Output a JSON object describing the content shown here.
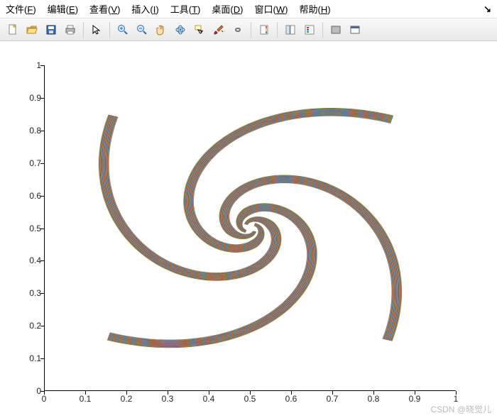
{
  "menu": {
    "items": [
      {
        "label": "文件",
        "key": "F"
      },
      {
        "label": "编辑",
        "key": "E"
      },
      {
        "label": "查看",
        "key": "V"
      },
      {
        "label": "插入",
        "key": "I"
      },
      {
        "label": "工具",
        "key": "T"
      },
      {
        "label": "桌面",
        "key": "D"
      },
      {
        "label": "窗口",
        "key": "W"
      },
      {
        "label": "帮助",
        "key": "H"
      }
    ]
  },
  "toolbar": {
    "icons": [
      "new",
      "open",
      "save",
      "print",
      "pointer",
      "zoom-in",
      "zoom-out",
      "pan",
      "rotate",
      "datacursor",
      "brush",
      "link",
      "colorbar",
      "legend",
      "insert-rect",
      "insert-box",
      "dock",
      "undock"
    ]
  },
  "chart_data": {
    "type": "line",
    "title": "",
    "xlabel": "",
    "ylabel": "",
    "xlim": [
      0,
      1
    ],
    "ylim": [
      0,
      1
    ],
    "xticks": [
      0,
      0.1,
      0.2,
      0.3,
      0.4,
      0.5,
      0.6,
      0.7,
      0.8,
      0.9,
      1
    ],
    "yticks": [
      0,
      0.1,
      0.2,
      0.3,
      0.4,
      0.5,
      0.6,
      0.7,
      0.8,
      0.9,
      1
    ],
    "note": "Four logarithmic spiral arms converging to center (0.5, 0.5); each arm rendered as a band of many offset colored strokes producing a striped tube effect.",
    "center": [
      0.5,
      0.5
    ],
    "arms": 4,
    "arm_start_corners": [
      [
        0,
        1
      ],
      [
        1,
        1
      ],
      [
        1,
        0
      ],
      [
        0,
        0
      ]
    ],
    "spiral": {
      "a": 0.015,
      "b": 0.55,
      "theta_range": [
        0,
        6.3
      ],
      "band_halfwidth": 0.012,
      "strokes_per_arm": 40
    },
    "palette": [
      "#0072BD",
      "#D95319",
      "#EDB120",
      "#7E2F8E",
      "#77AC30",
      "#4DBEEE",
      "#A2142F"
    ]
  },
  "watermark": "CSDN @晓觉儿"
}
